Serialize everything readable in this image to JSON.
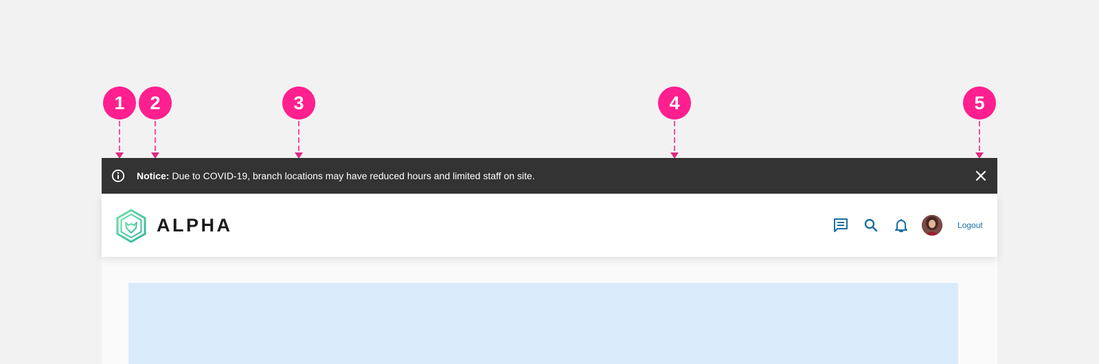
{
  "annotations": [
    {
      "number": "1"
    },
    {
      "number": "2"
    },
    {
      "number": "3"
    },
    {
      "number": "4"
    },
    {
      "number": "5"
    }
  ],
  "notice": {
    "icon": "info-circle-icon",
    "lead": "Notice:",
    "message": "Due to COVID-19, branch locations may have reduced hours and limited staff on site.",
    "close_icon": "close-icon"
  },
  "header": {
    "brand_name": "ALPHA",
    "logo": "hexagon-lion-logo",
    "icons": [
      "message-icon",
      "search-icon",
      "bell-icon"
    ],
    "logout_label": "Logout",
    "accent_color": "#1a6fa0"
  },
  "colors": {
    "notice_background": "#333333",
    "annotation": "#ff1f8e",
    "content_placeholder": "#d9eafb",
    "brand_gradient": [
      "#39c6a0",
      "#6fe0a8"
    ]
  }
}
